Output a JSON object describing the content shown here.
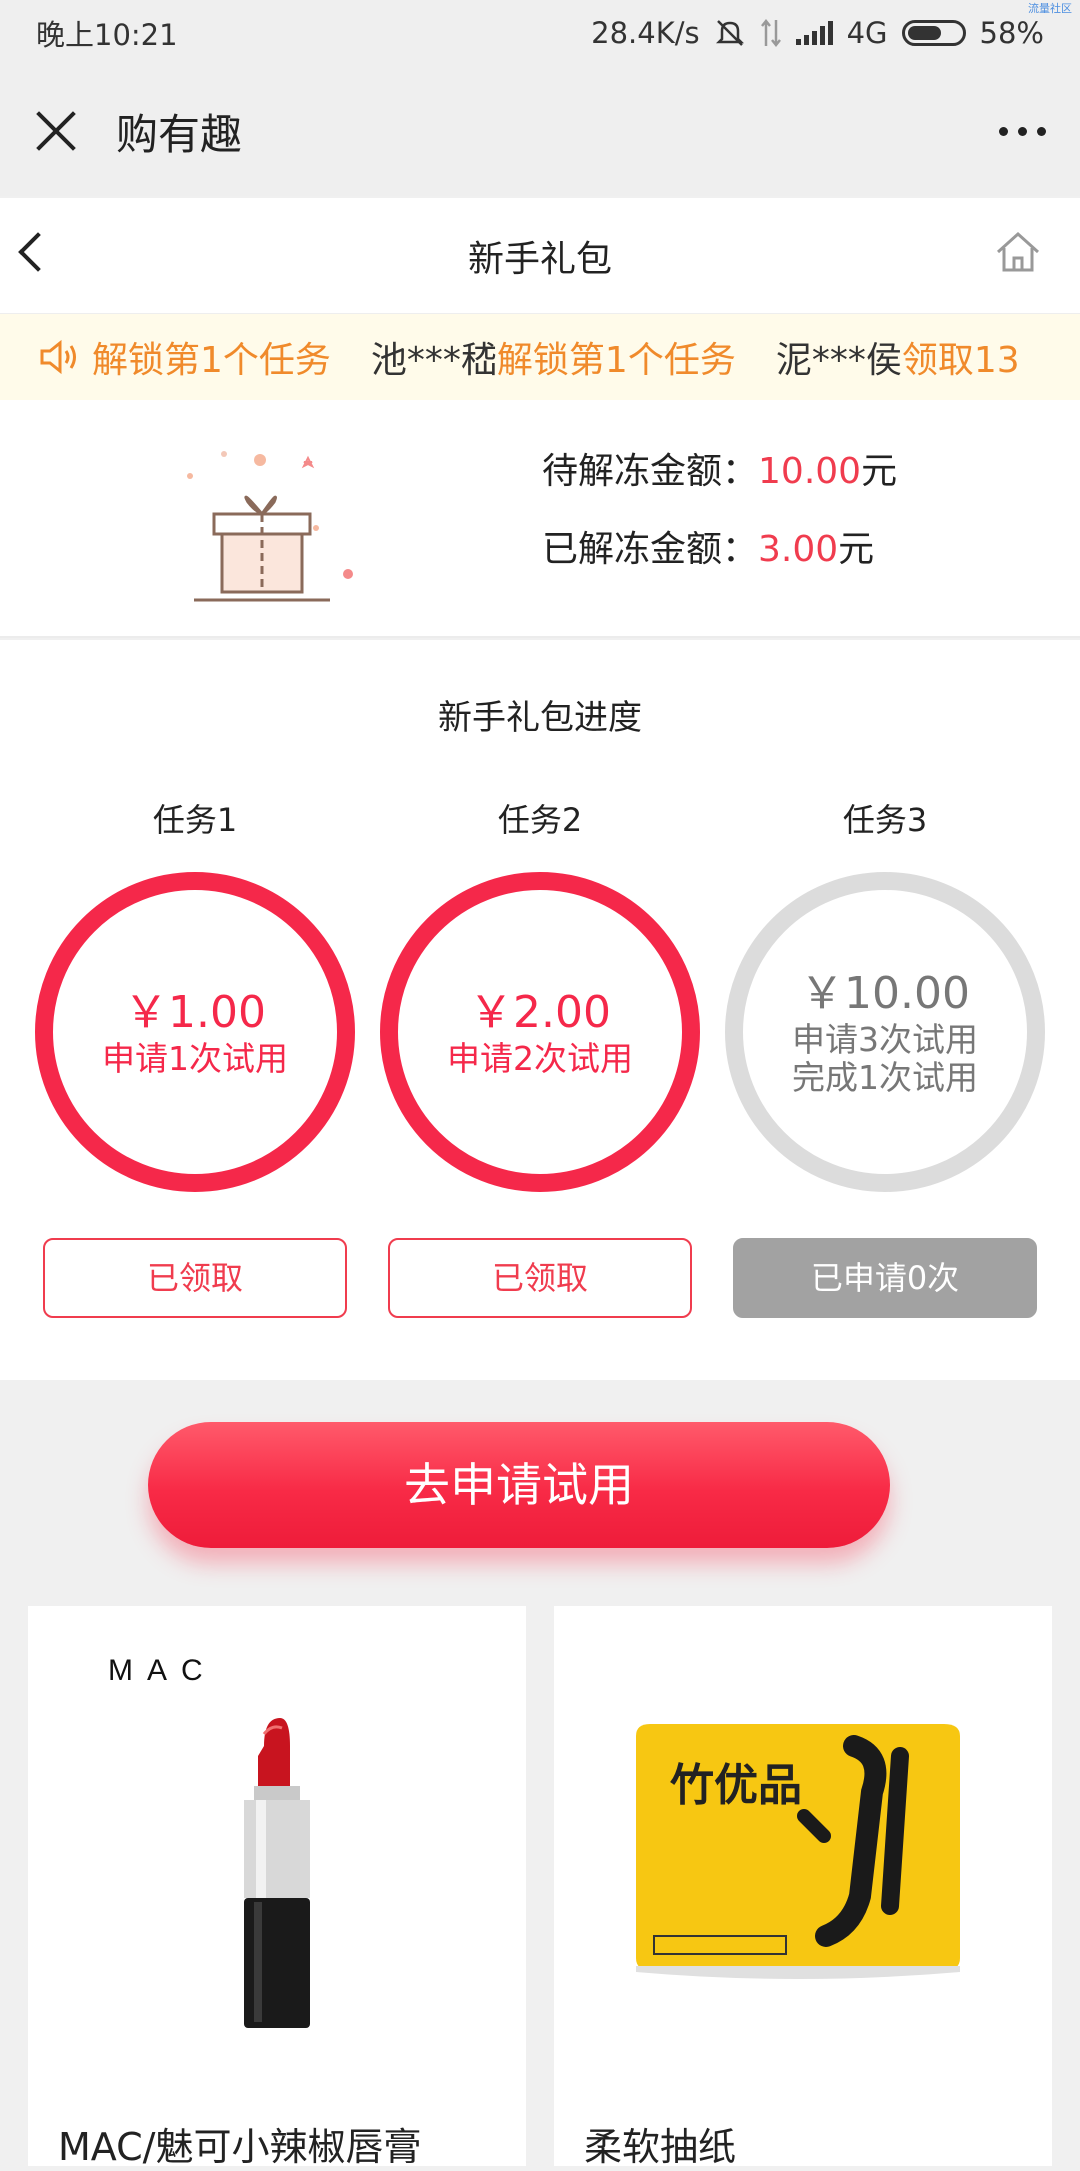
{
  "status_bar": {
    "time": "晚上10:21",
    "speed": "28.4K/s",
    "network": "4G",
    "battery": "58%",
    "corner_mark": "流量社区"
  },
  "app_bar": {
    "title": "购有趣"
  },
  "header": {
    "title": "新手礼包"
  },
  "ticker": [
    {
      "user": "",
      "action": "解锁第1个任务"
    },
    {
      "user": "池***嵇",
      "action": "解锁第1个任务"
    },
    {
      "user": "泥***侯",
      "action": "领取13"
    }
  ],
  "amounts": {
    "pending_label": "待解冻金额：",
    "pending_value": "10.00",
    "released_label": "已解冻金额：",
    "released_value": "3.00",
    "unit": "元"
  },
  "progress": {
    "title": "新手礼包进度",
    "tasks": [
      {
        "label": "任务1",
        "amount": "￥1.00",
        "desc": "申请1次试用",
        "desc2": "",
        "button": "已领取",
        "state": "done"
      },
      {
        "label": "任务2",
        "amount": "￥2.00",
        "desc": "申请2次试用",
        "desc2": "",
        "button": "已领取",
        "state": "done"
      },
      {
        "label": "任务3",
        "amount": "￥10.00",
        "desc": "申请3次试用",
        "desc2": "完成1次试用",
        "button": "已申请0次",
        "state": "pending"
      }
    ]
  },
  "cta": {
    "label": "去申请试用"
  },
  "products": [
    {
      "name": "MAC/魅可小辣椒唇膏",
      "brand": "MAC",
      "icon": "lipstick-image"
    },
    {
      "name": "柔软抽纸",
      "brand": "竹优品",
      "icon": "tissue-pack-image"
    }
  ],
  "colors": {
    "accent": "#f5284a",
    "ticker_action": "#f08a2b",
    "grey": "#dcdcdc"
  }
}
